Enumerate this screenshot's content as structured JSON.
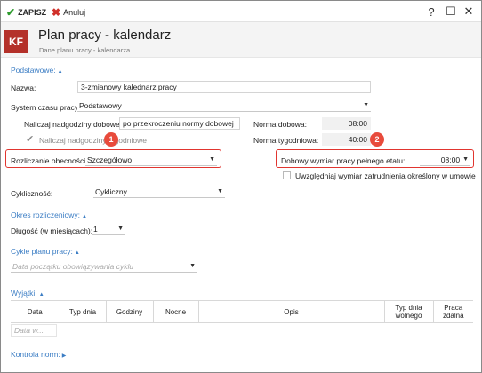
{
  "toolbar": {
    "save_label": "ZAPISZ",
    "cancel_label": "Anuluj",
    "help": "?",
    "restore": "☐",
    "close": "✕"
  },
  "header": {
    "logo": "KF",
    "title": "Plan pracy - kalendarz",
    "subtitle": "Dane planu pracy - kalendarza"
  },
  "basic": {
    "section_label": "Podstawowe:",
    "name_label": "Nazwa:",
    "name_value": "3-zmianowy kalednarz pracy",
    "system_label": "System czasu pracy:",
    "system_value": "Podstawowy",
    "overtime_daily_label": "Naliczaj nadgodziny dobowe:",
    "overtime_daily_value": "po przekroczeniu normy dobowej",
    "norm_daily_label": "Norma dobowa:",
    "norm_daily_value": "08:00",
    "overtime_weekly_label": "Naliczaj nadgodziny tygodniowe",
    "norm_weekly_label": "Norma tygodniowa:",
    "norm_weekly_value": "40:00",
    "settlement_label": "Rozliczanie obecności:",
    "settlement_value": "Szczegółowo",
    "daily_dim_label": "Dobowy wymiar pracy pełnego etatu:",
    "daily_dim_value": "08:00",
    "consider_label": "Uwzględniaj wymiar zatrudnienia określony w umowie",
    "cycle_label": "Cykliczność:",
    "cycle_value": "Cykliczny"
  },
  "badges": [
    "1",
    "2"
  ],
  "period": {
    "section_label": "Okres rozliczeniowy:",
    "length_label": "Długość (w miesiącach):",
    "length_value": "1"
  },
  "cycles": {
    "section_label": "Cykle planu pracy:",
    "date_placeholder": "Data początku obowiązywania cyklu"
  },
  "exceptions": {
    "section_label": "Wyjątki:",
    "columns": [
      "Data",
      "Typ dnia",
      "Godziny",
      "Nocne",
      "Opis",
      "Typ dnia wolnego",
      "Praca zdalna"
    ],
    "date_placeholder": "Data w..."
  },
  "norm_control": {
    "section_label": "Kontrola norm:"
  },
  "icons": {
    "save": "check-icon",
    "cancel": "x-icon",
    "dropdown": "chevron-down-icon",
    "collapse": "triangle-up-icon"
  },
  "colors": {
    "accent": "#3b7dc4",
    "logo": "#b4312a",
    "highlight": "#e1352f"
  }
}
